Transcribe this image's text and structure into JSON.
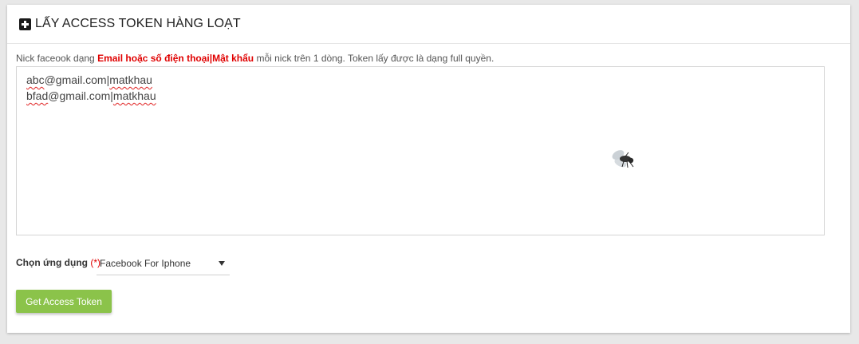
{
  "panel": {
    "title": "LẤY ACCESS TOKEN HÀNG LOẠT",
    "icon": "plus-square-icon"
  },
  "hint": {
    "prefix": "Nick faceook dạng ",
    "highlight": "Email hoặc số điện thoại|Mật khẩu",
    "suffix": " mỗi nick trên 1 dòng. Token lấy được là dạng full quyền.",
    "highlight_color": "#e00000"
  },
  "accounts_textarea": {
    "lines": [
      {
        "user": "abc",
        "rest": "@gmail.com|",
        "pass": "matkhau"
      },
      {
        "user": "bfad",
        "rest": "@gmail.com|",
        "pass": "matkhau"
      }
    ]
  },
  "app_select": {
    "label": "Chọn ứng dụng",
    "required_mark": "(*)",
    "value": "Facebook For Iphone"
  },
  "submit": {
    "label": "Get Access Token",
    "color": "#8bc34a"
  },
  "decoration": {
    "icon": "fly-icon"
  }
}
